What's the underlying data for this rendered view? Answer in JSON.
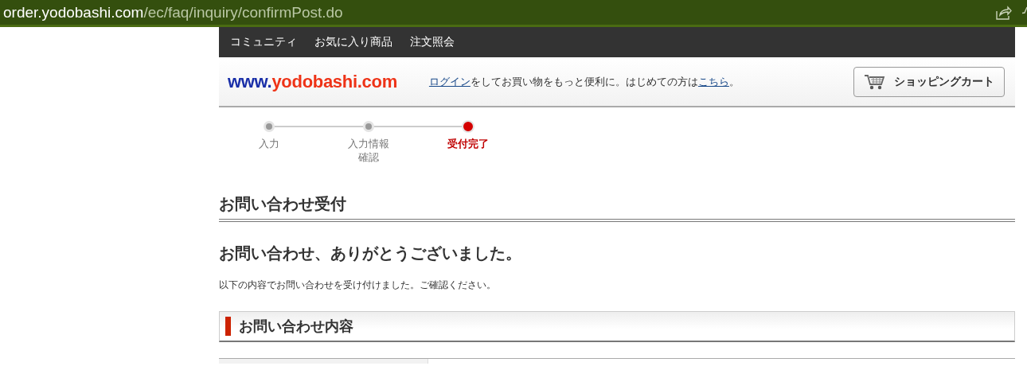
{
  "address_bar": {
    "host": "order.yodobashi.com",
    "path": "/ec/faq/inquiry/confirmPost.do"
  },
  "nav": [
    "コミュニティ",
    "お気に入り商品",
    "注文照会"
  ],
  "logo": {
    "prefix": "www.",
    "name": "yodobashi.com"
  },
  "login_message": [
    {
      "kind": "link",
      "text": "ログイン"
    },
    {
      "kind": "text",
      "text": "をしてお買い物をもっと便利に。はじめての方は"
    },
    {
      "kind": "link",
      "text": "こちら"
    },
    {
      "kind": "text",
      "text": "。"
    }
  ],
  "cart_button": "ショッピングカート",
  "steps": [
    {
      "label": "入力",
      "selected": false
    },
    {
      "label": "入力情報確認",
      "selected": false
    },
    {
      "label": "受付完了",
      "selected": true
    }
  ],
  "page_title": "お問い合わせ受付",
  "thanks_heading": "お問い合わせ、ありがとうございました。",
  "message": "以下の内容でお問い合わせを受け付けました。ご確認ください。",
  "section_title": "お問い合わせ内容"
}
